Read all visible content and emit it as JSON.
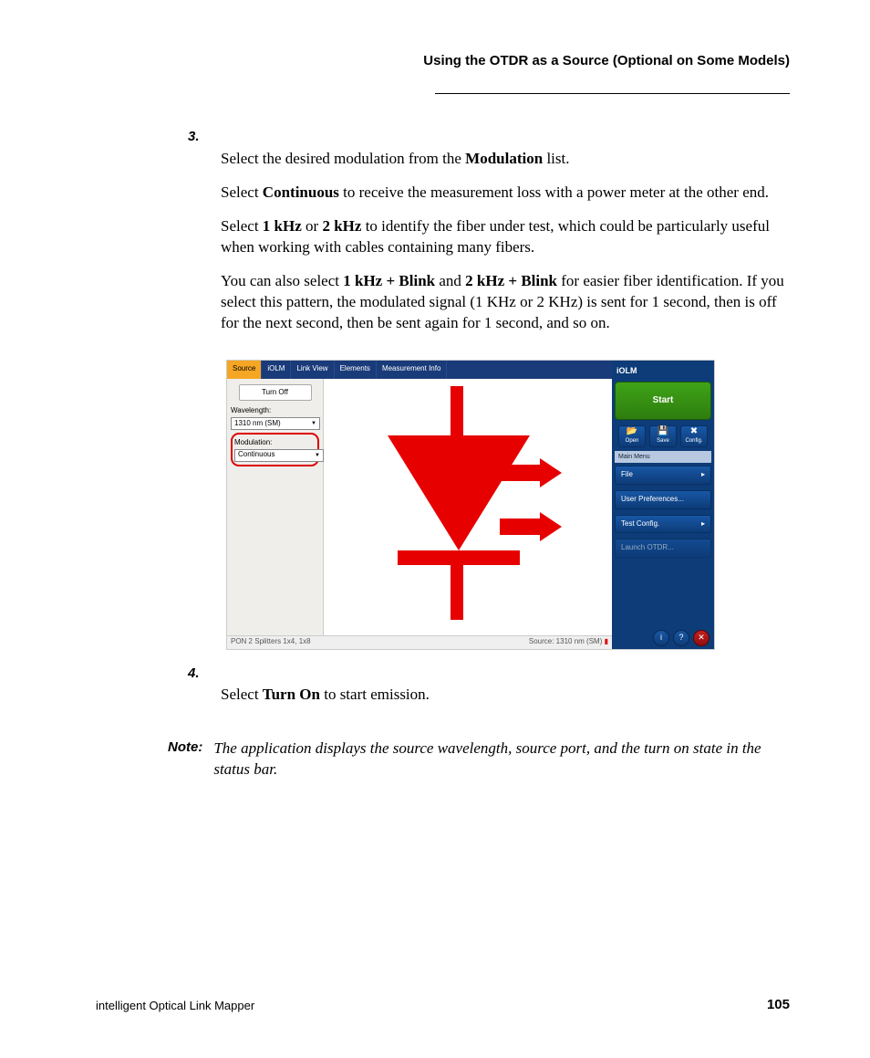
{
  "header": {
    "title": "Using the OTDR as a Source (Optional on Some Models)"
  },
  "steps": {
    "s3": {
      "num": "3.",
      "p1a": "Select the desired modulation from the ",
      "p1b": "Modulation",
      "p1c": " list.",
      "p2a": "Select ",
      "p2b": "Continuous",
      "p2c": " to receive the measurement loss with a power meter at the other end.",
      "p3a": "Select ",
      "p3b": "1 kHz",
      "p3c": " or ",
      "p3d": "2 kHz",
      "p3e": " to identify the fiber under test, which could be particularly useful when working with cables containing many fibers.",
      "p4a": "You can also select ",
      "p4b": "1 kHz + Blink",
      "p4c": " and ",
      "p4d": "2 kHz + Blink",
      "p4e": " for easier fiber identification. If you select this pattern, the modulated signal (1 KHz or 2 KHz) is sent for 1 second, then is off for the next second, then be sent again for 1 second, and so on."
    },
    "s4": {
      "num": "4.",
      "p1a": "Select ",
      "p1b": "Turn On",
      "p1c": " to start emission."
    }
  },
  "note": {
    "label": "Note:",
    "body": "The application displays the source wavelength, source port, and the turn on state in the status bar."
  },
  "screenshot": {
    "tabs": {
      "source": "Source",
      "iolm": "iOLM",
      "linkview": "Link View",
      "elements": "Elements",
      "measinfo": "Measurement Info"
    },
    "left": {
      "turnoff": "Turn Off",
      "wavelength_label": "Wavelength:",
      "wavelength_value": "1310 nm (SM)",
      "modulation_label": "Modulation:",
      "modulation_value": "Continuous"
    },
    "status": {
      "left": "PON 2 Splitters 1x4, 1x8",
      "right": "Source: 1310 nm (SM)"
    },
    "right": {
      "title": "iOLM",
      "start": "Start",
      "open": "Open",
      "save": "Save",
      "config": "Config.",
      "mainmenu": "Main Menu",
      "file": "File",
      "userprefs": "User Preferences...",
      "testconfig": "Test Config.",
      "launchotdr": "Launch OTDR..."
    }
  },
  "footer": {
    "left": "intelligent Optical Link Mapper",
    "page": "105"
  }
}
